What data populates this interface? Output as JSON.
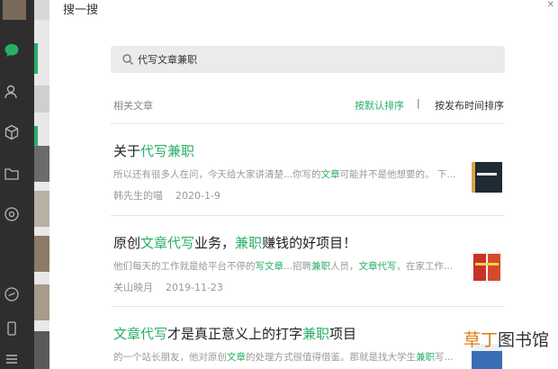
{
  "window": {
    "title": "搜一搜"
  },
  "search": {
    "query": "代写文章兼职"
  },
  "results_bar": {
    "label": "相关文章",
    "sort_default": "按默认排序",
    "separator": "|",
    "sort_time": "按发布时间排序"
  },
  "articles": [
    {
      "title_parts": [
        "关于",
        "代写兼职"
      ],
      "summary_parts": [
        "所以还有很多人在问，今天给大家讲清楚...你写的",
        "文章",
        "可能并不是他想要的。 下..."
      ],
      "author": "韩先生的喵",
      "date": "2020-1-9"
    },
    {
      "title_parts": [
        "原创",
        "文章代写",
        "业务，",
        "兼职",
        "赚钱的好项目！"
      ],
      "summary_parts": [
        "他们每天的工作就是给平台不停的",
        "写文章",
        "...招聘",
        "兼职",
        "人员，",
        "文章代写",
        "，在家工作..."
      ],
      "author": "关山映月",
      "date": "2019-11-23"
    },
    {
      "title_parts": [
        "文章代写",
        "才是真正意义上的打字",
        "兼职",
        "项目"
      ],
      "summary_parts": [
        "的一个站长朋友，他对原创",
        "文章",
        "的处理方式很值得借鉴。那就是找大学生",
        "兼职",
        "写..."
      ]
    }
  ],
  "watermark": {
    "part1": "草丁",
    "part2": "图书馆"
  },
  "colors": {
    "accent": "#2aae67",
    "rail": "#2e2e2e"
  }
}
